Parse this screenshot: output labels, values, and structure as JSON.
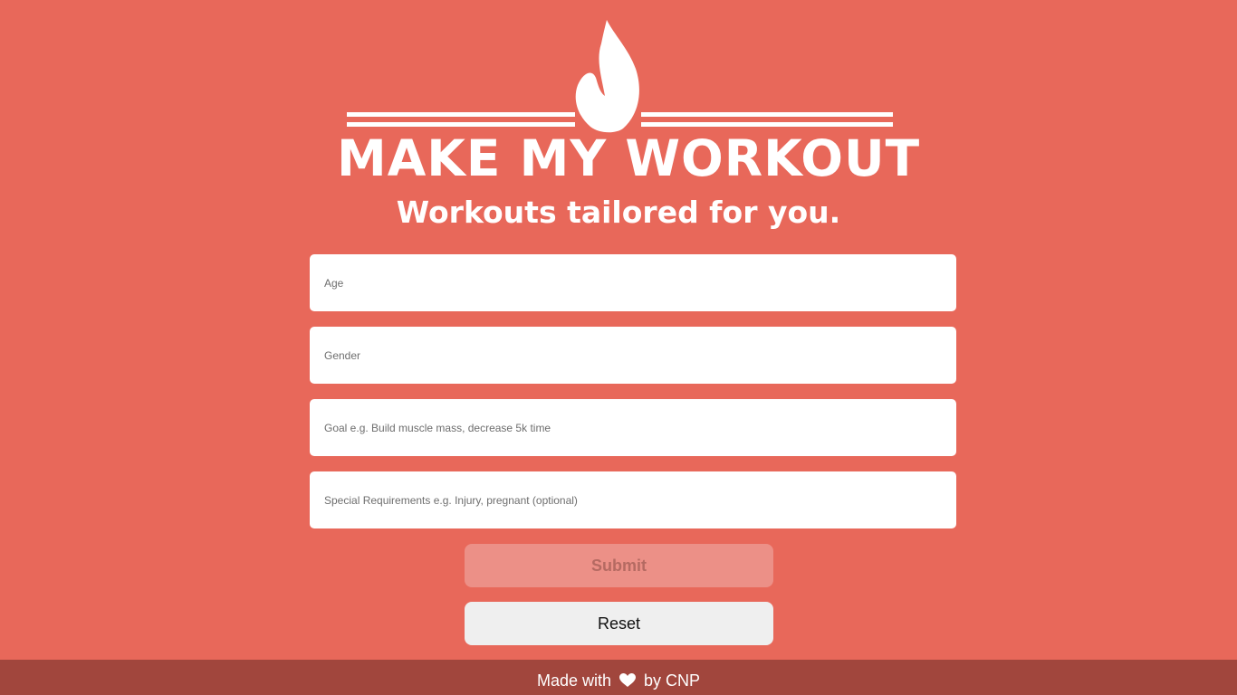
{
  "logo": {
    "title": "MAKE MY WORKOUT",
    "tagline": "Workouts tailored for you.",
    "icon": "flame-icon"
  },
  "form": {
    "age_placeholder": "Age",
    "gender_placeholder": "Gender",
    "goal_placeholder": "Goal e.g. Build muscle mass, decrease 5k time",
    "requirements_placeholder": "Special Requirements e.g. Injury, pregnant (optional)",
    "submit_label": "Submit",
    "reset_label": "Reset"
  },
  "footer": {
    "prefix": "Made with",
    "icon": "heart-icon",
    "suffix": "by CNP"
  },
  "colors": {
    "background": "#e8685a",
    "footer_background": "#a1463d",
    "submit_disabled": "#ec9087",
    "reset_background": "#efefef"
  }
}
